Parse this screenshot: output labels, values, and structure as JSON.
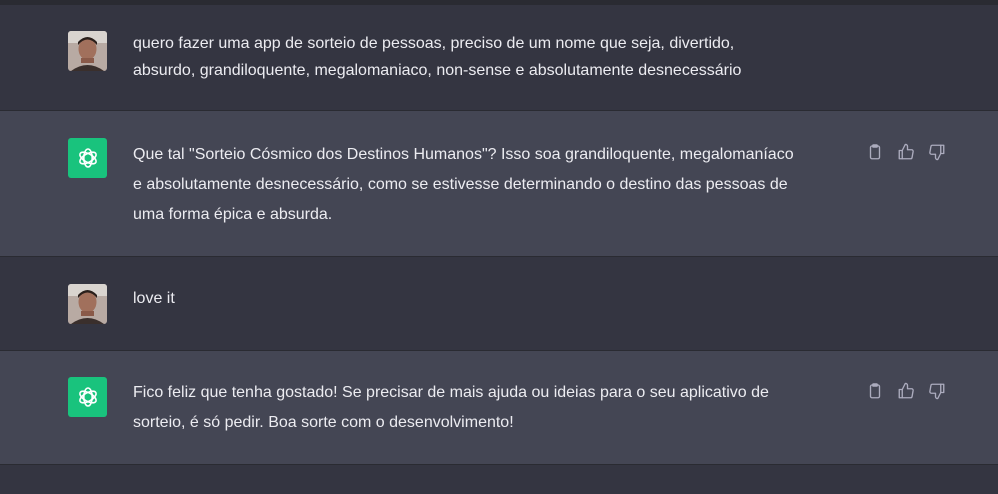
{
  "colors": {
    "background": "#343541",
    "assistant_bg": "#444654",
    "accent_bot": "#19c37d",
    "text": "#ececf1",
    "icon": "#acacbe"
  },
  "conversation": {
    "messages": [
      {
        "role": "user",
        "lines": [
          "quero fazer uma app de sorteio de pessoas, preciso de um nome que seja, divertido,",
          "absurdo, grandiloquente, megalomaniaco, non-sense e absolutamente desnecessário"
        ]
      },
      {
        "role": "assistant",
        "lines": [
          "Que tal \"Sorteio Cósmico dos Destinos Humanos\"? Isso soa grandiloquente, megalomaníaco",
          "e absolutamente desnecessário, como se estivesse determinando o destino das pessoas de",
          "uma forma épica e absurda."
        ],
        "actions": [
          "copy-icon",
          "thumbs-up-icon",
          "thumbs-down-icon"
        ]
      },
      {
        "role": "user",
        "lines": [
          "love it"
        ]
      },
      {
        "role": "assistant",
        "lines": [
          "Fico feliz que tenha gostado! Se precisar de mais ajuda ou ideias para o seu aplicativo de",
          "sorteio, é só pedir. Boa sorte com o desenvolvimento!"
        ],
        "actions": [
          "copy-icon",
          "thumbs-up-icon",
          "thumbs-down-icon"
        ]
      }
    ]
  }
}
